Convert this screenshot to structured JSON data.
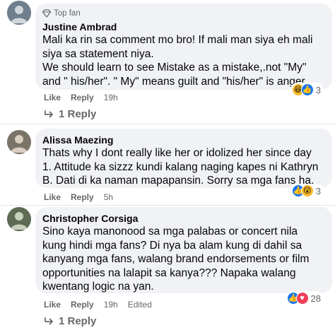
{
  "comments": [
    {
      "badge": "Top fan",
      "author": "Justine Ambrad",
      "text": "Mali ka rin sa comment mo bro! If mali man siya eh mali\nsiya sa statement niya.\nWe should learn to see Mistake as a mistake,.not \"My\"\nand \" his/her\". \" My\" means guilt and \"his/her\" is anger.",
      "reaction_icons": [
        "haha-icon",
        "like-icon"
      ],
      "reaction_count": "3",
      "like_label": "Like",
      "reply_label": "Reply",
      "time": "19h",
      "replies_label": "1 Reply"
    },
    {
      "author": "Alissa Maezing",
      "text": "Thats why I dont really like her or idolized her since day\n1. Attitude ka sizzz kundi kalang naging kapes ni Kathryn\nB. Dati di ka naman mapapansin. Sorry sa mga fans ha.",
      "reaction_icons": [
        "like-icon",
        "wow-icon"
      ],
      "reaction_count": "3",
      "like_label": "Like",
      "reply_label": "Reply",
      "time": "5h"
    },
    {
      "author": "Christopher Corsiga",
      "text": "Sino kaya manonood sa mga palabas or concert nila\nkung hindi mga fans? Di nya ba alam kung di dahil sa\nkanyang mga fans, walang brand endorsements or film\nopportunities na lalapit sa kanya??? Napaka walang\nkwentang logic na yan.",
      "reaction_icons": [
        "like-icon",
        "love-icon"
      ],
      "reaction_count": "28",
      "like_label": "Like",
      "reply_label": "Reply",
      "time": "19h",
      "edited_label": "Edited",
      "replies_label": "1 Reply"
    }
  ],
  "colors": {
    "bubble": "#f0f2f5",
    "meta_text": "#65676b",
    "like_blue": "#1877f2",
    "haha_yellow": "#f7b928",
    "love_red": "#f33e58"
  }
}
